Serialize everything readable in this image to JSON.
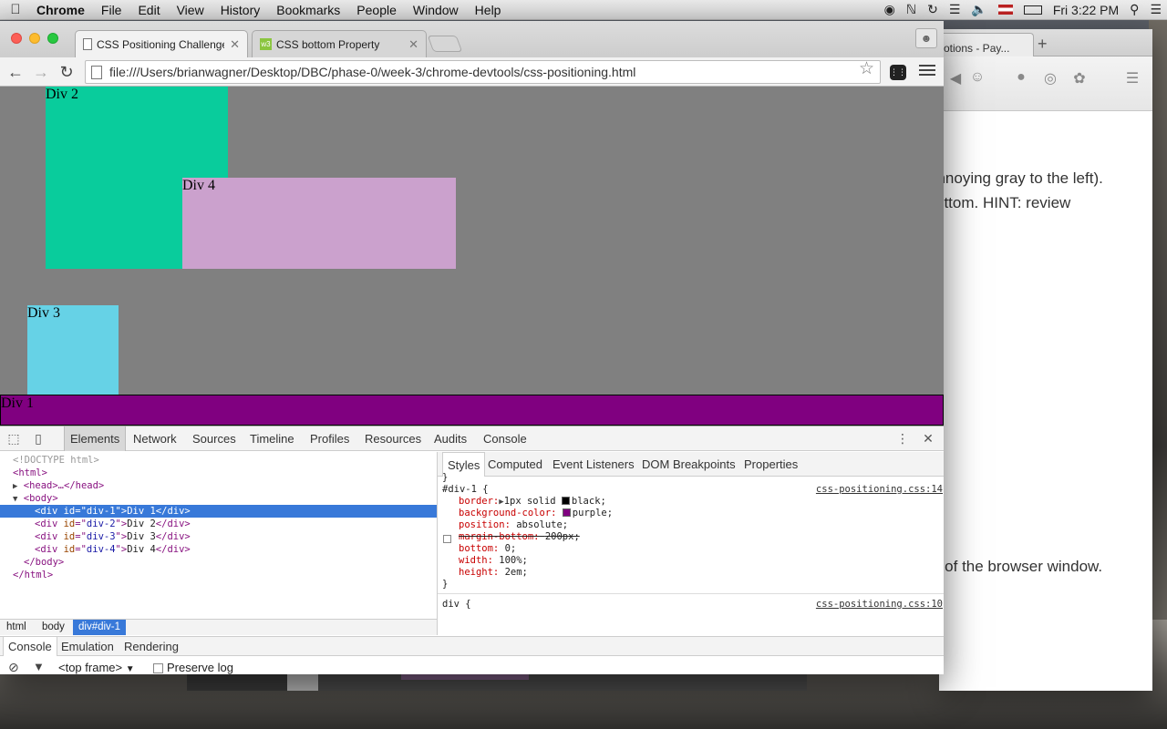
{
  "menubar": {
    "app": "Chrome",
    "items": [
      "File",
      "Edit",
      "View",
      "History",
      "Bookmarks",
      "People",
      "Window",
      "Help"
    ],
    "clock": "Fri 3:22 PM"
  },
  "bg_window": {
    "tab_label": "otions - Pay...",
    "lines": [
      "annoying gray to the left).",
      "ottom. HINT: review",
      "p of the browser window."
    ]
  },
  "tabs": [
    {
      "label": "CSS Positioning Challenge",
      "icon": "page-icon"
    },
    {
      "label": "CSS bottom Property",
      "icon": "w3schools-icon"
    }
  ],
  "address": {
    "url": "file:///Users/brianwagner/Desktop/DBC/phase-0/week-3/chrome-devtools/css-positioning.html"
  },
  "page": {
    "bg_color": "#808080",
    "divs": {
      "div1": "Div 1",
      "div2": "Div 2",
      "div3": "Div 3",
      "div4": "Div 4"
    }
  },
  "devtools": {
    "tabs": [
      "Elements",
      "Network",
      "Sources",
      "Timeline",
      "Profiles",
      "Resources",
      "Audits",
      "Console"
    ],
    "dom": {
      "doctype": "<!DOCTYPE html>",
      "html_open": "<html>",
      "head": "<head>…</head>",
      "body_open": "<body>",
      "divs": [
        {
          "id": "div-1",
          "text": "Div 1"
        },
        {
          "id": "div-2",
          "text": "Div 2"
        },
        {
          "id": "div-3",
          "text": "Div 3"
        },
        {
          "id": "div-4",
          "text": "Div 4"
        }
      ],
      "body_close": "</body>",
      "html_close": "</html>"
    },
    "breadcrumbs": [
      "html",
      "body",
      "div#div-1"
    ],
    "styles_tabs": [
      "Styles",
      "Computed",
      "Event Listeners",
      "DOM Breakpoints",
      "Properties"
    ],
    "rule1": {
      "selector": "#div-1 {",
      "source": "css-positioning.css:14",
      "border_prop": "border:",
      "border_val": "1px solid ",
      "border_color": "black;",
      "bg_prop": "background-color:",
      "bg_val": "purple;",
      "pos_prop": "position:",
      "pos_val": "absolute;",
      "mb_prop": "margin-bottom:",
      "mb_val": "200px;",
      "bottom_prop": "bottom:",
      "bottom_val": "0;",
      "width_prop": "width:",
      "width_val": "100%;",
      "height_prop": "height:",
      "height_val": "2em;",
      "close": "}"
    },
    "rule2": {
      "selector": "div {",
      "source": "css-positioning.css:10"
    },
    "drawer_tabs": [
      "Console",
      "Emulation",
      "Rendering"
    ],
    "frame_select": "<top frame>",
    "preserve_log": "Preserve log"
  }
}
